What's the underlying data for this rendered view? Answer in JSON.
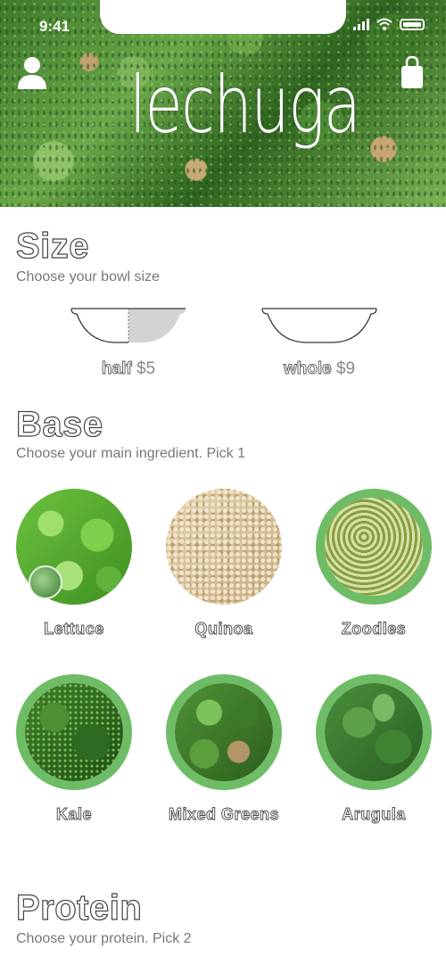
{
  "status_bar": {
    "time": "9:41"
  },
  "header": {
    "logo": "lechuga"
  },
  "size": {
    "title": "Size",
    "subtitle": "Choose your bowl size",
    "options": [
      {
        "name": "half",
        "price": "$5"
      },
      {
        "name": "whole",
        "price": "$9"
      }
    ]
  },
  "base": {
    "title": "Base",
    "subtitle": "Choose your main ingredient. Pick 1",
    "items": [
      {
        "label": "Lettuce"
      },
      {
        "label": "Quinoa"
      },
      {
        "label": "Zoodles"
      },
      {
        "label": "Kale"
      },
      {
        "label": "Mixed Greens"
      },
      {
        "label": "Arugula"
      }
    ]
  },
  "protein": {
    "title": "Protein",
    "subtitle": "Choose your protein. Pick 2"
  },
  "colors": {
    "accent_green": "#6ebd66",
    "bowl_fill": "#d3d3d3"
  },
  "icons": [
    "user-icon",
    "shopping-bag-icon",
    "signal-icon",
    "wifi-icon",
    "battery-icon"
  ]
}
